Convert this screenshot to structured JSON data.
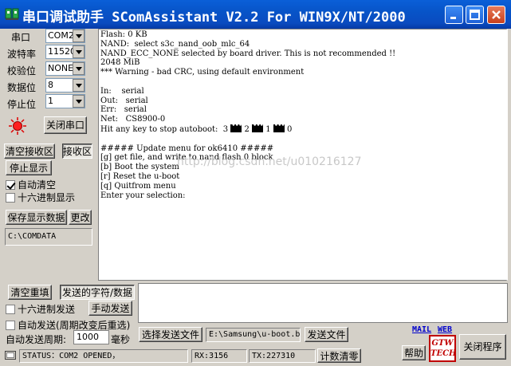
{
  "window": {
    "title": "串口调试助手 SComAssistant V2.2 For WIN9X/NT/2000"
  },
  "settings": {
    "port_label": "串口",
    "port_value": "COM2",
    "baud_label": "波特率",
    "baud_value": "11520",
    "parity_label": "校验位",
    "parity_value": "NONE",
    "databits_label": "数据位",
    "databits_value": "8",
    "stopbits_label": "停止位",
    "stopbits_value": "1"
  },
  "controls": {
    "close_port": "关闭串口",
    "clear_receive": "清空接收区",
    "receive_area": "接收区",
    "stop_display": "停止显示",
    "auto_clear": "自动清空",
    "hex_display": "十六进制显示",
    "save_data": "保存显示数据",
    "change": "更改",
    "save_path": "C:\\COMDATA",
    "clear_refill": "清空重填",
    "send_label": "发送的字符/数据",
    "hex_send": "十六进制发送",
    "manual_send": "手动发送",
    "auto_send": "自动发送(周期改变后重选)",
    "auto_period_label": "自动发送周期:",
    "auto_period_value": "1000",
    "ms": "毫秒",
    "select_file": "选择发送文件",
    "file_path": "E:\\Samsung\\u-boot.b",
    "send_file": "发送文件",
    "mail": "MAIL",
    "web": "WEB",
    "help": "帮助",
    "exit": "关闭程序",
    "logo": "GTW TECH"
  },
  "terminal": {
    "lines": [
      "Flash: 0 KB",
      "NAND:  select s3c_nand_oob_mlc_64",
      "NAND_ECC_NONE selected by board driver. This is not recommended !!",
      "2048 MiB",
      "*** Warning - bad CRC, using default environment",
      "",
      "In:    serial",
      "Out:   serial",
      "Err:   serial",
      "Net:   CS8900-0",
      "Hit any key to stop autoboot:  3 ",
      "",
      "##### Update menu for ok6410 #####",
      "[g] get file, and write to nand flash 0 block",
      "[b] Boot the system",
      "[r] Reset the u-boot",
      "[q] Quitfrom menu",
      "Enter your selection:"
    ],
    "countdown": [
      "2",
      "1",
      "0"
    ],
    "watermark": "http://blog.csdn.net/u010216127"
  },
  "status": {
    "status_text": "STATUS：COM2 OPENED，",
    "rx": "RX:3156",
    "tx": "TX:227310",
    "reset_count": "计数清零"
  },
  "colors": {
    "titlebar": "#0754c8",
    "face": "#d4d0c8",
    "link": "#0000cc",
    "indicator": "#e00000"
  }
}
